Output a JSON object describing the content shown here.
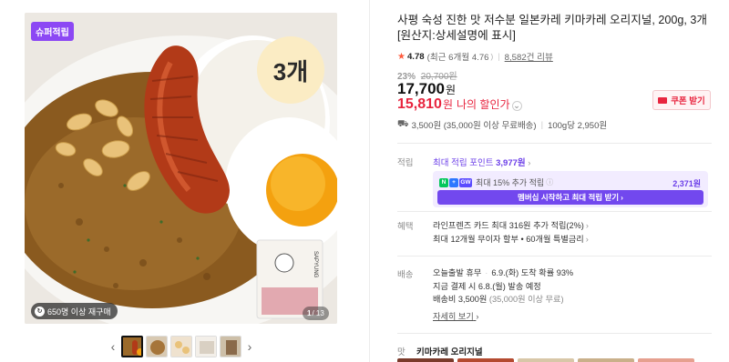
{
  "gallery": {
    "super_badge": "슈퍼적립",
    "quantity_bubble": "3개",
    "reorder_text": "650명 이상 재구매",
    "counter_current": "1",
    "counter_total": "/ 13",
    "prev_icon": "chevron-left-icon",
    "next_icon": "chevron-right-icon"
  },
  "product": {
    "title": "사평 숙성 진한 맛 저수분 일본카레 키마카레 오리지널, 200g, 3개 [원산지:상세설명에 표시]",
    "rating_score": "4.78",
    "rating_recent": "(최근 6개월 4.76",
    "review_count": "8,582건 리뷰",
    "discount_rate": "23%",
    "original_price": "20,700원",
    "price": "17,700",
    "price_unit": "원",
    "member_price": "15,810",
    "member_price_unit": "원",
    "member_price_label": "나의 할인가",
    "coupon_label": "쿠폰 받기",
    "delivery_fee": "3,500원 (35,000원 이상 무료배송)",
    "unit_price": "100g당 2,950원"
  },
  "points": {
    "label": "적립",
    "max_text": "최대 적립 포인트",
    "max_amount": "3,977원",
    "box_text": "최대 15% 추가 적립",
    "box_amount": "2,371원",
    "membership_button": "멤버십 시작하고 최대 적립 받기"
  },
  "benefits": {
    "label": "혜택",
    "line1": "라인프렌즈 카드 최대 316원 추가 적립(2%)",
    "line2": "최대 12개월 무이자 할부 • 60개월 특별금리"
  },
  "shipping": {
    "label": "배송",
    "line1_a": "오늘출발 휴무",
    "line1_b": "6.9.(화) 도착 확률 93%",
    "line2": "지금 결제 시 6.8.(월) 발송 예정",
    "line3_a": "배송비 3,500원",
    "line3_b": "(35,000원 이상 무료)",
    "more": "자세히 보기"
  },
  "option": {
    "label": "맛",
    "value": "키마카레 오리지널"
  },
  "colors": {
    "accent_purple": "#6a3de8",
    "price_red": "#e8253f",
    "badge_purple": "#8c48f4"
  }
}
